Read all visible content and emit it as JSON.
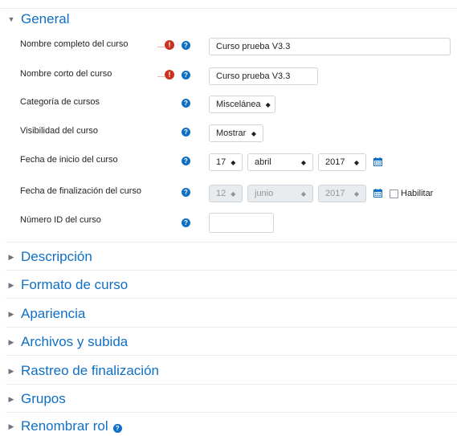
{
  "sections": {
    "general": "General",
    "descripcion": "Descripción",
    "formato": "Formato de curso",
    "apariencia": "Apariencia",
    "archivos": "Archivos y subida",
    "rastreo": "Rastreo de finalización",
    "grupos": "Grupos",
    "renombrar": "Renombrar rol"
  },
  "fields": {
    "fullname_label": "Nombre completo del curso",
    "fullname_value": "Curso prueba V3.3",
    "shortname_label": "Nombre corto del curso",
    "shortname_value": "Curso prueba V3.3",
    "category_label": "Categoría de cursos",
    "category_value": "Miscelánea",
    "visibility_label": "Visibilidad del curso",
    "visibility_value": "Mostrar",
    "startdate_label": "Fecha de inicio del curso",
    "startdate_day": "17",
    "startdate_month": "abril",
    "startdate_year": "2017",
    "enddate_label": "Fecha de finalización del curso",
    "enddate_day": "12",
    "enddate_month": "junio",
    "enddate_year": "2017",
    "enddate_enable_label": "Habilitar",
    "enddate_enabled": false,
    "idnumber_label": "Número ID del curso",
    "idnumber_value": ""
  },
  "icons": {
    "required": "required-icon",
    "help": "help-icon",
    "calendar": "calendar-icon",
    "expanded": "triangle-down-icon",
    "collapsed": "triangle-right-icon"
  },
  "colors": {
    "link": "#0f6fc5",
    "required": "#ca3120",
    "disabled_bg": "#e9ecef"
  }
}
